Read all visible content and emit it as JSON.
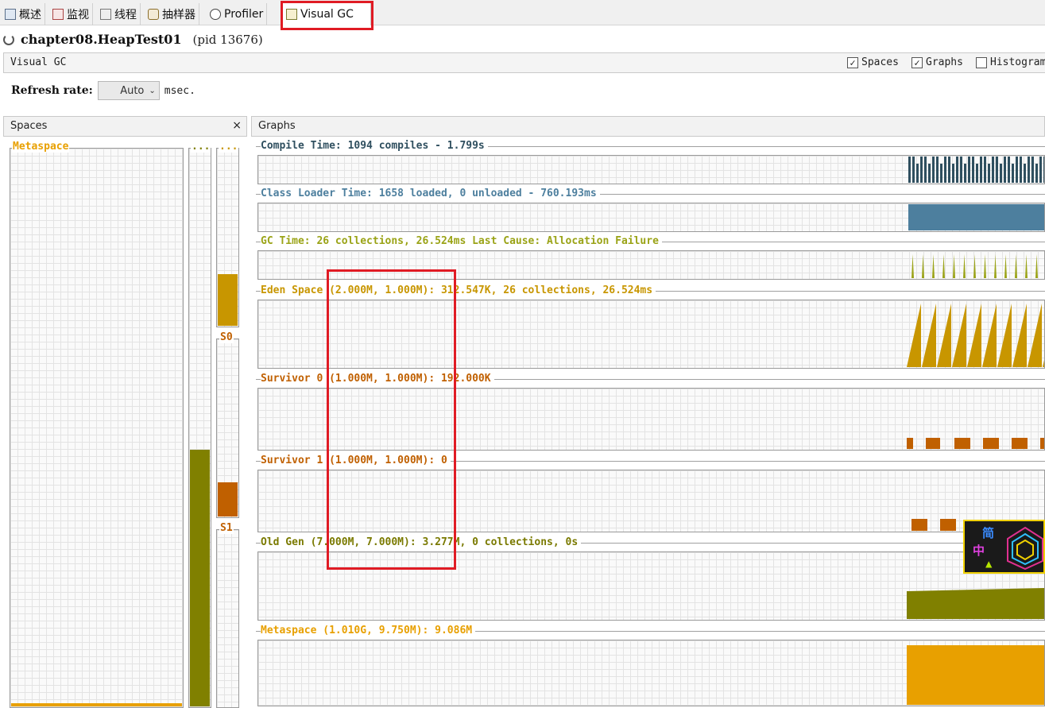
{
  "tabs": [
    {
      "label": "概述",
      "icon": "overview-icon"
    },
    {
      "label": "监视",
      "icon": "monitor-icon"
    },
    {
      "label": "线程",
      "icon": "threads-icon"
    },
    {
      "label": "抽样器",
      "icon": "sampler-icon"
    },
    {
      "label": "Profiler",
      "icon": "profiler-icon"
    },
    {
      "label": "Visual GC",
      "icon": "visual-gc-icon",
      "active": true
    }
  ],
  "app": {
    "title": "chapter08.HeapTest01",
    "pid": "(pid 13676)"
  },
  "toolbar": {
    "label": "Visual GC",
    "checkboxes": [
      {
        "label": "Spaces",
        "checked": true
      },
      {
        "label": "Graphs",
        "checked": true
      },
      {
        "label": "Histogram",
        "checked": false
      }
    ]
  },
  "refresh": {
    "label": "Refresh rate:",
    "value": "Auto",
    "unit": "msec."
  },
  "panels": {
    "spaces": "Spaces",
    "graphs": "Graphs",
    "close": "×"
  },
  "spaces": {
    "metaspace": {
      "label": "Metaspace",
      "fill": 0.006
    },
    "old": {
      "label": "...",
      "fill": 0.46
    },
    "eden": {
      "label": "...",
      "fill": 0.29
    },
    "s0": {
      "label": "S0",
      "fill": 0.19
    },
    "s1": {
      "label": "S1",
      "fill": 0.0
    }
  },
  "graphs": [
    {
      "title": "Compile Time: 1094 compiles - 1.799s",
      "color": "#2f4f5f"
    },
    {
      "title": "Class Loader Time: 1658 loaded, 0 unloaded - 760.193ms",
      "color": "#4d7f9e"
    },
    {
      "title": "GC Time: 26 collections, 26.524ms Last Cause: Allocation Failure",
      "color": "#9aa316"
    },
    {
      "title": "Eden Space (2.000M, 1.000M): 312.547K, 26 collections, 26.524ms",
      "color": "#c89600"
    },
    {
      "title": "Survivor 0 (1.000M, 1.000M): 192.000K",
      "color": "#c06000"
    },
    {
      "title": "Survivor 1 (1.000M, 1.000M): 0",
      "color": "#c06000"
    },
    {
      "title": "Old Gen (7.000M, 7.000M): 3.277M, 0 collections, 0s",
      "color": "#7a7a00"
    },
    {
      "title": "Metaspace (1.010G, 9.750M): 9.086M",
      "color": "#e8a000"
    }
  ],
  "badge": {
    "chars": [
      "简",
      "中"
    ]
  },
  "colors": {
    "highlight": "#e01b24",
    "metaspace": "#e8a000",
    "old": "#808000",
    "eden": "#c89600",
    "survivor": "#c06000"
  }
}
